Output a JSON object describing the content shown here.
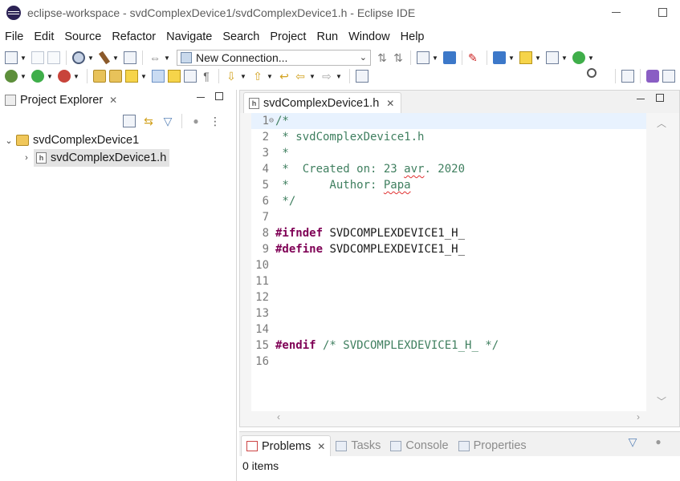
{
  "window": {
    "title": "eclipse-workspace - svdComplexDevice1/svdComplexDevice1.h - Eclipse IDE"
  },
  "menu": {
    "items": [
      "File",
      "Edit",
      "Source",
      "Refactor",
      "Navigate",
      "Search",
      "Project",
      "Run",
      "Window",
      "Help"
    ]
  },
  "toolbar": {
    "connection_select_value": "New Connection..."
  },
  "project_explorer": {
    "tab_label": "Project Explorer",
    "project_name": "svdComplexDevice1",
    "file_name": "svdComplexDevice1.h"
  },
  "editor": {
    "tab_label": "svdComplexDevice1.h",
    "lines": [
      {
        "n": "1",
        "parts": [
          {
            "t": "/*",
            "c": "comment"
          }
        ],
        "fold": "⊖",
        "current": true
      },
      {
        "n": "2",
        "parts": [
          {
            "t": " * svdComplexDevice1.h",
            "c": "comment"
          }
        ]
      },
      {
        "n": "3",
        "parts": [
          {
            "t": " *",
            "c": "comment"
          }
        ]
      },
      {
        "n": "4",
        "parts": [
          {
            "t": " *  Created on: 23 ",
            "c": "comment"
          },
          {
            "t": "avr",
            "c": "comment squiggle"
          },
          {
            "t": ". 2020",
            "c": "comment"
          }
        ]
      },
      {
        "n": "5",
        "parts": [
          {
            "t": " *      Author: ",
            "c": "comment"
          },
          {
            "t": "Papa",
            "c": "comment squiggle"
          }
        ]
      },
      {
        "n": "6",
        "parts": [
          {
            "t": " */",
            "c": "comment"
          }
        ]
      },
      {
        "n": "7",
        "parts": []
      },
      {
        "n": "8",
        "parts": [
          {
            "t": "#ifndef",
            "c": "kw"
          },
          {
            "t": " SVDCOMPLEXDEVICE1_H_",
            "c": "plain"
          }
        ]
      },
      {
        "n": "9",
        "parts": [
          {
            "t": "#define",
            "c": "kw"
          },
          {
            "t": " SVDCOMPLEXDEVICE1_H_",
            "c": "plain"
          }
        ]
      },
      {
        "n": "10",
        "parts": []
      },
      {
        "n": "11",
        "parts": []
      },
      {
        "n": "12",
        "parts": []
      },
      {
        "n": "13",
        "parts": []
      },
      {
        "n": "14",
        "parts": []
      },
      {
        "n": "15",
        "parts": [
          {
            "t": "#endif",
            "c": "kw"
          },
          {
            "t": " /* SVDCOMPLEXDEVICE1_H_ */",
            "c": "comment"
          }
        ]
      },
      {
        "n": "16",
        "parts": []
      }
    ]
  },
  "bottom_panel": {
    "tabs": [
      {
        "label": "Problems",
        "active": true
      },
      {
        "label": "Tasks",
        "active": false
      },
      {
        "label": "Console",
        "active": false
      },
      {
        "label": "Properties",
        "active": false
      }
    ],
    "status": "0 items"
  },
  "colors": {
    "comment": "#3f7f5f",
    "keyword": "#7f0055",
    "current_line": "#e8f2fe"
  }
}
